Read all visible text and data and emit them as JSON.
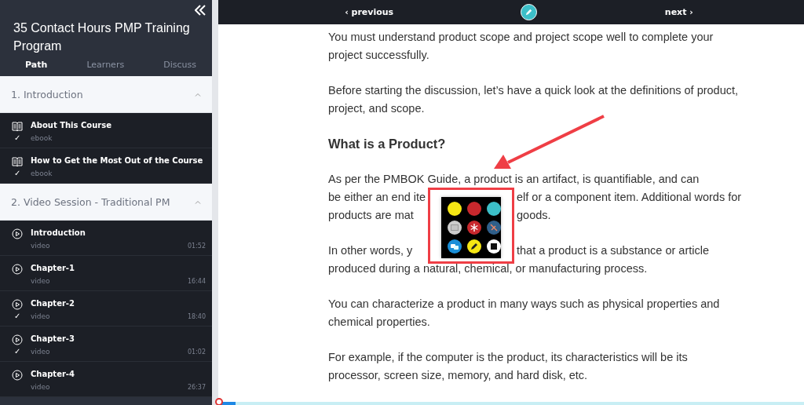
{
  "sidebar": {
    "title": "35 Contact Hours PMP Training Program",
    "tabs": [
      {
        "label": "Path",
        "selected": true
      },
      {
        "label": "Learners",
        "selected": false
      },
      {
        "label": "Discuss",
        "selected": false
      }
    ],
    "sections": [
      {
        "title": "1. Introduction",
        "expanded": true,
        "items": [
          {
            "kind": "ebook",
            "title": "About This Course",
            "type": "ebook",
            "check": "✓"
          },
          {
            "kind": "ebook",
            "title": "How to Get the Most Out of the Course",
            "type": "ebook",
            "check": "✓"
          }
        ]
      },
      {
        "title": "2. Video Session - Traditional PM",
        "expanded": true,
        "items": [
          {
            "kind": "video",
            "title": "Introduction",
            "type": "video",
            "duration": "01:52"
          },
          {
            "kind": "video",
            "title": "Chapter-1",
            "type": "video",
            "duration": "16:44"
          },
          {
            "kind": "video",
            "title": "Chapter-2",
            "type": "video",
            "duration": "18:40",
            "check": "✓"
          },
          {
            "kind": "video",
            "title": "Chapter-3",
            "type": "video",
            "duration": "01:02",
            "check": "✓"
          },
          {
            "kind": "video",
            "title": "Chapter-4",
            "type": "video",
            "duration": "26:37"
          }
        ]
      }
    ]
  },
  "nav": {
    "previous": "‹ previous",
    "next": "next ›"
  },
  "content": {
    "paragraphs": [
      {
        "kind": "text",
        "text": "You must understand product scope and project scope well to complete your project successfully."
      },
      {
        "kind": "text",
        "text": "Before starting the discussion, let’s have a quick look at the definitions of product, project, and scope."
      },
      {
        "kind": "heading",
        "text": "What is a Product?"
      }
    ],
    "covered_paragraphs": [
      {
        "lines": [
          [
            "As per the PMBOK Guide, a product is an artifact, is quantifiable, and can"
          ],
          [
            "be either an end ite",
            "elf or a component item. Additional words for"
          ],
          [
            "products are mat",
            "goods."
          ]
        ]
      },
      {
        "lines": [
          [
            "In other words, y",
            "that a product is a substance or article"
          ],
          [
            "produced during a natural, chemical, or manufacturing process."
          ]
        ]
      }
    ],
    "more_paragraphs": [
      {
        "kind": "text",
        "text": "You can characterize a product in many ways such as physical properties and chemical properties."
      },
      {
        "kind": "text",
        "text": "For example, if the computer is the product, its characteristics will be its processor, screen size, memory, and hard disk, etc."
      }
    ]
  },
  "palette": [
    {
      "kind": "color",
      "color": "#f5e614"
    },
    {
      "kind": "color",
      "color": "#c8282d"
    },
    {
      "kind": "color",
      "color": "#3cbfc8"
    },
    {
      "kind": "notes"
    },
    {
      "kind": "asterisk"
    },
    {
      "kind": "pin-off"
    },
    {
      "kind": "chat"
    },
    {
      "kind": "pencil"
    },
    {
      "kind": "square"
    }
  ],
  "progress": {
    "level": 0.03
  }
}
